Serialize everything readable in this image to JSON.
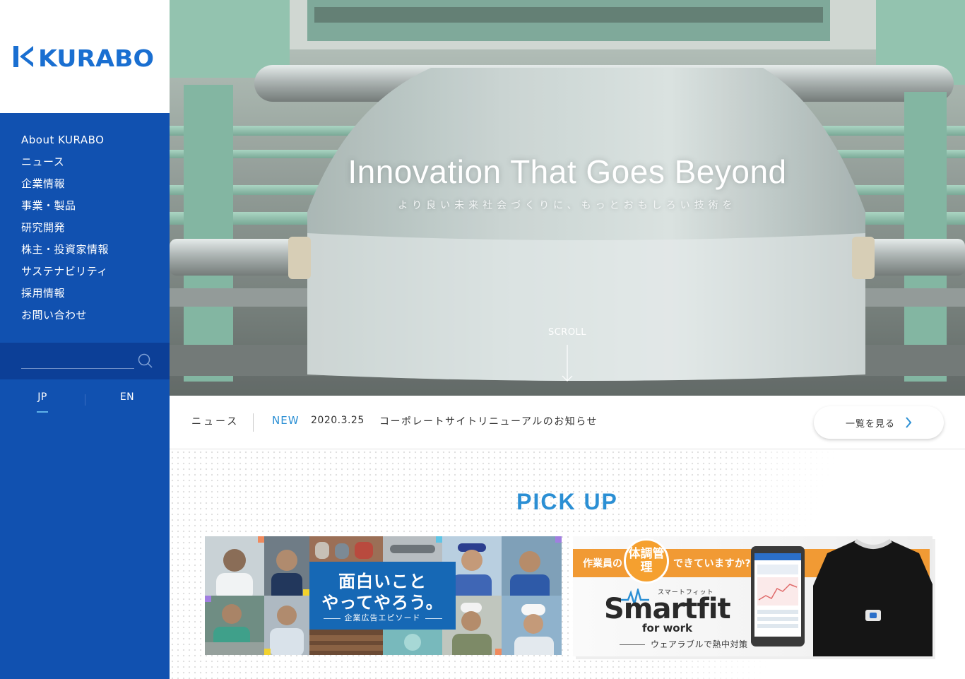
{
  "brand": {
    "logo_text": "KURABO",
    "color": "#1151b0",
    "accent": "#2b8fd4"
  },
  "nav": {
    "items": [
      {
        "label": "About KURABO"
      },
      {
        "label": "ニュース"
      },
      {
        "label": "企業情報"
      },
      {
        "label": "事業・製品"
      },
      {
        "label": "研究開発"
      },
      {
        "label": "株主・投資家情報"
      },
      {
        "label": "サステナビリティ"
      },
      {
        "label": "採用情報"
      },
      {
        "label": "お問い合わせ"
      }
    ]
  },
  "search": {
    "value": "",
    "placeholder": "",
    "icon": "search-icon"
  },
  "language": {
    "options": [
      "JP",
      "EN"
    ],
    "selected": "JP"
  },
  "hero": {
    "title": "Innovation That Goes Beyond",
    "subtitle": "より良い未来社会づくりに、もっとおもしろい技術を",
    "scroll_label": "SCROLL"
  },
  "news": {
    "label": "ニュース",
    "badge": "NEW",
    "date": "2020.3.25",
    "title": "コーポレートサイトリニューアルのお知らせ",
    "more_label": "一覧を見る"
  },
  "pickup": {
    "heading": "PICK UP",
    "cards": [
      {
        "title_line1": "面白いこと",
        "title_line2": "やってやろう。",
        "caption": "企業広告エピソード"
      },
      {
        "lead": "作業員の",
        "badge": "体調管理",
        "lead_suffix": "できていますか?",
        "ruby": "スマートフィット",
        "brand": "Smartfit",
        "sub": "for work",
        "caption": "ウェアラブルで熱中対策"
      }
    ]
  }
}
